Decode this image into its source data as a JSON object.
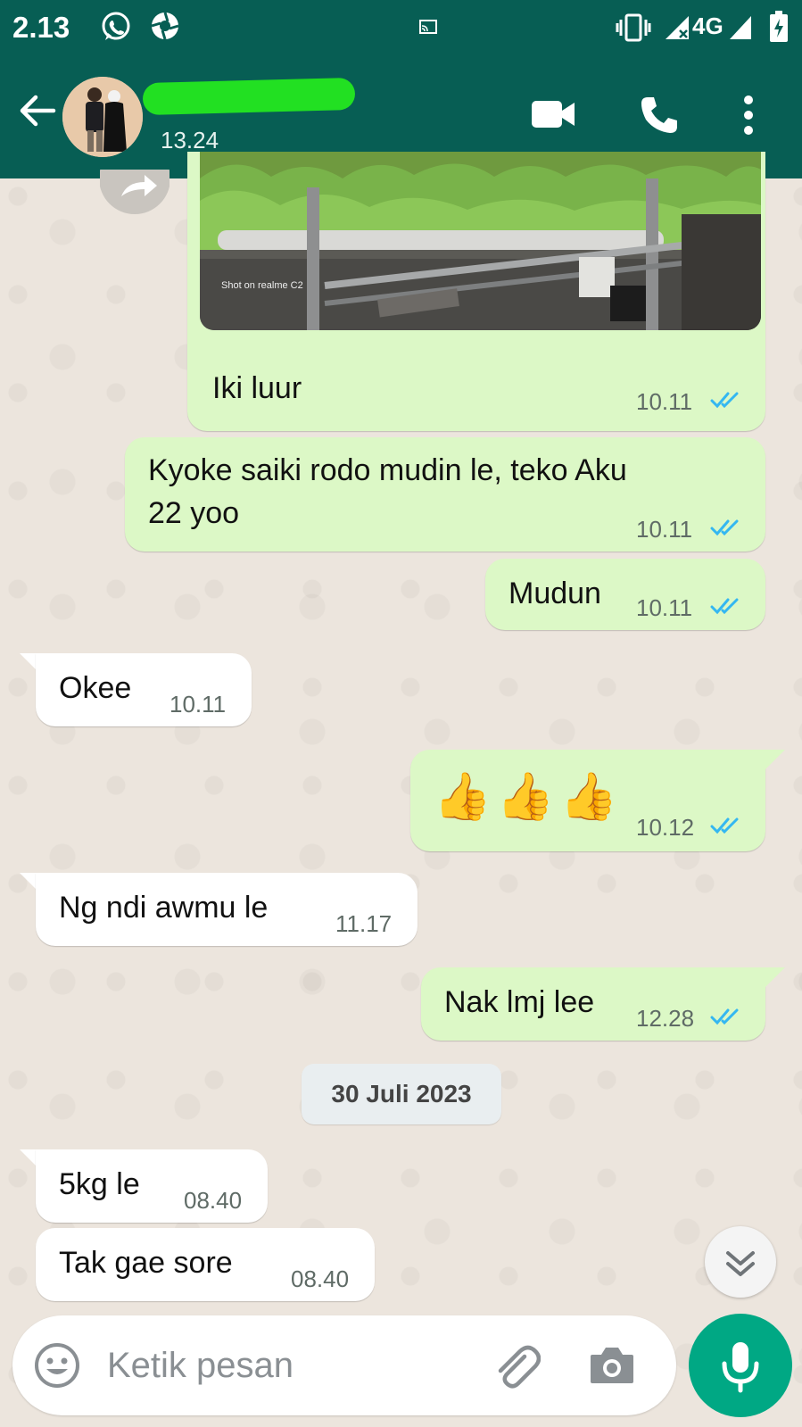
{
  "status_bar": {
    "time": "2.13",
    "network": "4G"
  },
  "header": {
    "contact_name": "",
    "last_seen": "13.24"
  },
  "messages": [
    {
      "dir": "out",
      "text": "Iki luur",
      "time": "10.11",
      "image_watermark": "Shot on realme C2"
    },
    {
      "dir": "out",
      "text_line1": "Kyoke saiki rodo mudin le, teko Aku",
      "text_line2": "22 yoo",
      "time": "10.11"
    },
    {
      "dir": "out",
      "text": "Mudun",
      "time": "10.11"
    },
    {
      "dir": "in",
      "text": "Okee",
      "time": "10.11"
    },
    {
      "dir": "out",
      "text": "👍👍👍",
      "time": "10.12"
    },
    {
      "dir": "in",
      "text": "Ng ndi awmu le",
      "time": "11.17"
    },
    {
      "dir": "out",
      "text": "Nak lmj lee",
      "time": "12.28"
    },
    {
      "dir": "in",
      "text": "5kg le",
      "time": "08.40"
    },
    {
      "dir": "in",
      "text": "Tak gae sore",
      "time": "08.40"
    }
  ],
  "date_separator": "30 Juli 2023",
  "composer": {
    "placeholder": "Ketik pesan"
  },
  "colors": {
    "header": "#075e54",
    "outgoing": "#dcf8c6",
    "incoming": "#ffffff",
    "read_ticks": "#34b7f1",
    "mic": "#00a884"
  }
}
